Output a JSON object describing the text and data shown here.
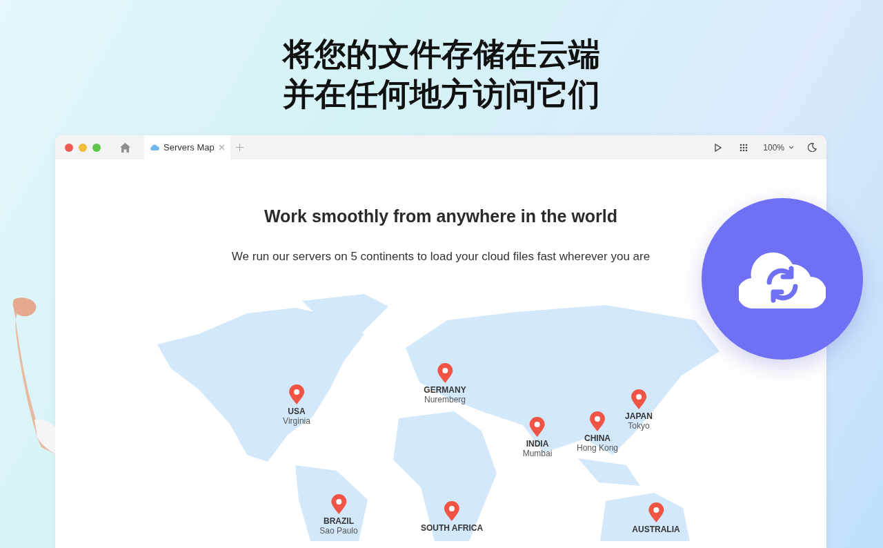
{
  "headline": [
    "将您的文件存储在云端",
    "并在任何地方访问它们"
  ],
  "browser": {
    "tabs": [
      {
        "label": "Servers Map",
        "selected": true
      }
    ],
    "zoom": "100%"
  },
  "page": {
    "title": "Work smoothly from anywhere in the world",
    "subtitle": "We run our servers on 5 continents to load your cloud files fast wherever you are"
  },
  "locations": [
    {
      "country": "USA",
      "city": "Virginia"
    },
    {
      "country": "GERMANY",
      "city": "Nuremberg"
    },
    {
      "country": "INDIA",
      "city": "Mumbai"
    },
    {
      "country": "CHINA",
      "city": "Hong Kong"
    },
    {
      "country": "JAPAN",
      "city": "Tokyo"
    },
    {
      "country": "BRAZIL",
      "city": "Sao Paulo"
    },
    {
      "country": "SOUTH AFRICA"
    },
    {
      "country": "AUSTRALIA"
    }
  ]
}
